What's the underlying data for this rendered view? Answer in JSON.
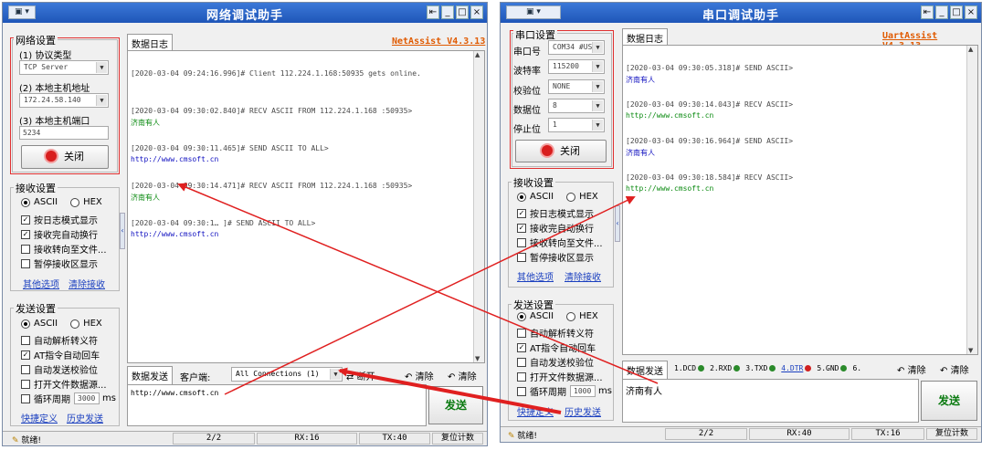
{
  "net": {
    "title": "网络调试助手",
    "brand": "NetAssist V4.3.13",
    "net_settings": {
      "title": "网络设置",
      "protocol_label": "(1) 协议类型",
      "protocol_value": "TCP Server",
      "host_addr_label": "(2) 本地主机地址",
      "host_addr_value": "172.24.58.140",
      "host_port_label": "(3) 本地主机端口",
      "host_port_value": "5234",
      "close_button": "关闭"
    },
    "recv_settings": {
      "title": "接收设置",
      "ascii": "ASCII",
      "hex": "HEX",
      "options": [
        "按日志模式显示",
        "接收完自动换行",
        "接收转向至文件...",
        "暂停接收区显示"
      ],
      "checked": [
        true,
        true,
        false,
        false
      ],
      "link_more": "其他选项",
      "link_clear": "清除接收"
    },
    "send_settings": {
      "title": "发送设置",
      "ascii": "ASCII",
      "hex": "HEX",
      "options": [
        "自动解析转义符",
        "AT指令自动回车",
        "自动发送校验位",
        "打开文件数据源...",
        "循环周期"
      ],
      "checked": [
        false,
        true,
        false,
        false,
        false
      ],
      "period_value": "3000",
      "period_unit": "ms",
      "link_shortcut": "快捷定义",
      "link_history": "历史发送"
    },
    "log_tab": "数据日志",
    "log": [
      {
        "header": "[2020-03-04 09:24:16.996]# Client 112.224.1.168:50935 gets online.",
        "body": "",
        "type": "info"
      },
      {
        "header": "[2020-03-04 09:30:02.840]# RECV ASCII FROM 112.224.1.168 :50935>",
        "body": "济南有人",
        "type": "recv"
      },
      {
        "header": "[2020-03-04 09:30:11.465]# SEND ASCII TO ALL>",
        "body": "http://www.cmsoft.cn",
        "type": "send"
      },
      {
        "header": "[2020-03-04 09:30:14.471]# RECV ASCII FROM 112.224.1.168 :50935>",
        "body": "济南有人",
        "type": "recv"
      },
      {
        "header": "[2020-03-04 09:30:1… ]# SEND ASCII TO ALL>",
        "body": "http://www.cmsoft.cn",
        "type": "send"
      }
    ],
    "send_tab": "数据发送",
    "client_label": "客户端:",
    "client_value": "All Connections (1)",
    "disconnect": "断开",
    "clear1": "清除",
    "clear2": "清除",
    "send_text": "http://www.cmsoft.cn",
    "send_button": "发送",
    "status": {
      "ready": "就绪!",
      "count": "2/2",
      "rx": "RX:16",
      "tx": "TX:40",
      "reset": "复位计数"
    }
  },
  "uart": {
    "title": "串口调试助手",
    "brand": "UartAssist V4.3.13",
    "serial_settings": {
      "title": "串口设置",
      "port_label": "串口号",
      "port_value": "COM34 #US",
      "baud_label": "波特率",
      "baud_value": "115200",
      "parity_label": "校验位",
      "parity_value": "NONE",
      "databits_label": "数据位",
      "databits_value": "8",
      "stopbits_label": "停止位",
      "stopbits_value": "1",
      "close_button": "关闭"
    },
    "recv_settings": {
      "title": "接收设置",
      "ascii": "ASCII",
      "hex": "HEX",
      "options": [
        "按日志模式显示",
        "接收完自动换行",
        "接收转向至文件...",
        "暂停接收区显示"
      ],
      "checked": [
        true,
        true,
        false,
        false
      ],
      "link_more": "其他选项",
      "link_clear": "清除接收"
    },
    "send_settings": {
      "title": "发送设置",
      "ascii": "ASCII",
      "hex": "HEX",
      "options": [
        "自动解析转义符",
        "AT指令自动回车",
        "自动发送校验位",
        "打开文件数据源...",
        "循环周期"
      ],
      "checked": [
        false,
        true,
        false,
        false,
        false
      ],
      "period_value": "1000",
      "period_unit": "ms",
      "link_shortcut": "快捷定义",
      "link_history": "历史发送"
    },
    "log_tab": "数据日志",
    "log": [
      {
        "header": "[2020-03-04 09:30:05.318]# SEND ASCII>",
        "body": "济南有人",
        "type": "send"
      },
      {
        "header": "[2020-03-04 09:30:14.043]# RECV ASCII>",
        "body": "http://www.cmsoft.cn",
        "type": "recv"
      },
      {
        "header": "[2020-03-04 09:30:16.964]# SEND ASCII>",
        "body": "济南有人",
        "type": "send"
      },
      {
        "header": "[2020-03-04 09:30:18.584]# RECV ASCII>",
        "body": "http://www.cmsoft.cn",
        "type": "recv"
      }
    ],
    "send_tab": "数据发送",
    "signals": [
      "1.DCD",
      "2.RXD",
      "3.TXD",
      "4.DTR",
      "5.GND",
      "6."
    ],
    "clear1": "清除",
    "clear2": "清除",
    "send_text": "济南有人",
    "send_button": "发送",
    "status": {
      "ready": "就绪!",
      "count": "2/2",
      "rx": "RX:40",
      "tx": "TX:16",
      "reset": "复位计数"
    }
  },
  "colors": {
    "title_bar": "#2a66c8",
    "annotation": "#e02020",
    "recv_text": "#0a8a10",
    "send_text": "#1010c0",
    "brand": "#e05a00"
  }
}
